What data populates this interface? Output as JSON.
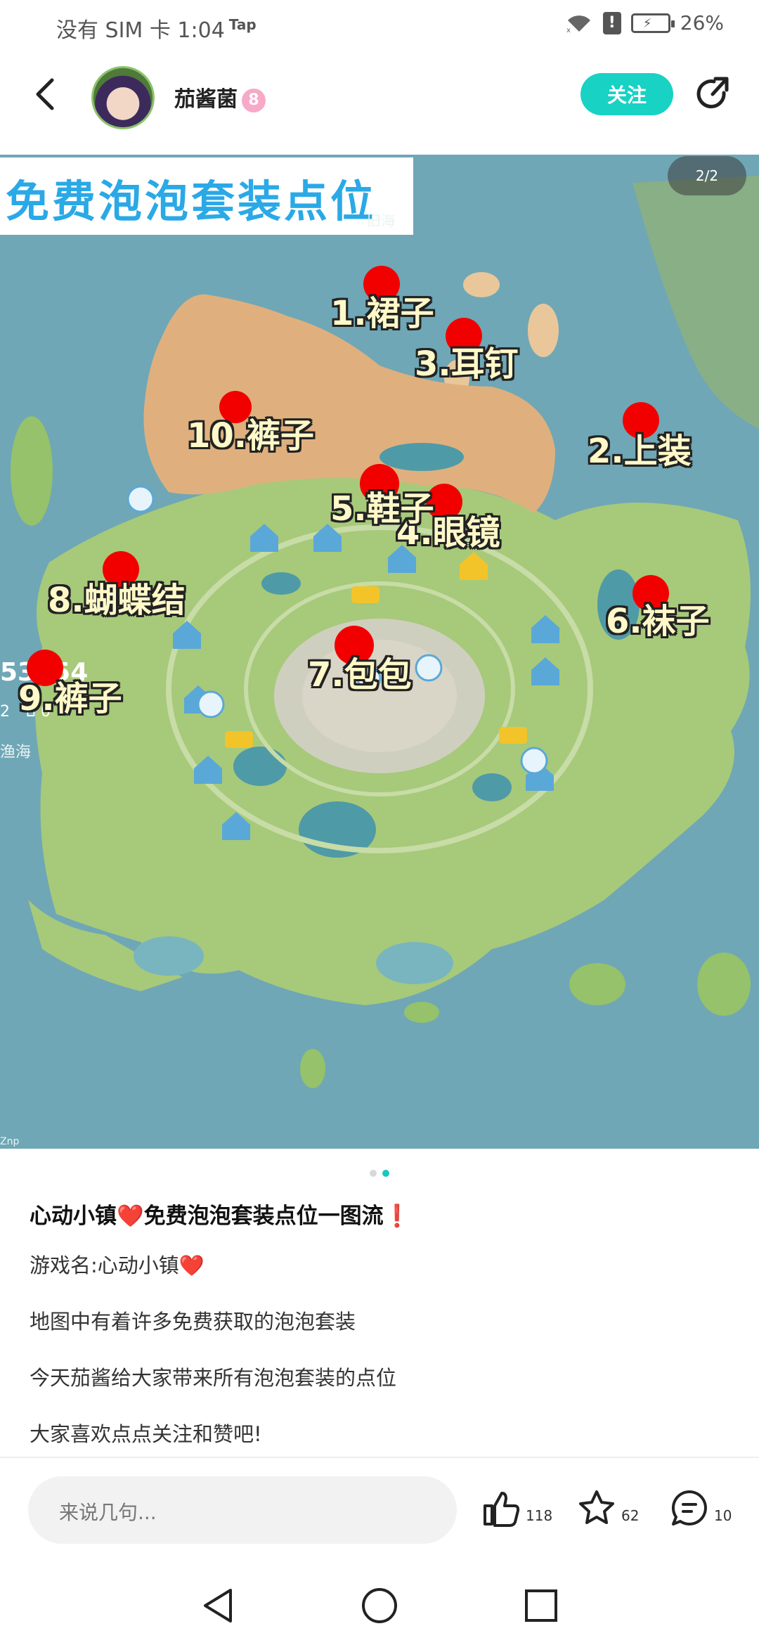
{
  "status_bar": {
    "carrier": "没有 SIM 卡",
    "time": "1:04",
    "tap_badge": "Tap",
    "alert_icon_text": "!",
    "battery": "26%"
  },
  "header": {
    "username": "茄酱菌",
    "level": "8",
    "follow_label": "关注"
  },
  "map_image": {
    "banner_title": "免费泡泡套装点位",
    "page_indicator": "2/2",
    "markers": [
      {
        "label": "1.裙子"
      },
      {
        "label": "2.上装"
      },
      {
        "label": "3.耳钉"
      },
      {
        "label": "4.眼镜"
      },
      {
        "label": "5.鞋子"
      },
      {
        "label": "6.袜子"
      },
      {
        "label": "7.包包"
      },
      {
        "label": "8.蝴蝶结"
      },
      {
        "label": "9.裤子"
      },
      {
        "label": "10.裤子"
      }
    ],
    "map_texts": {
      "old_sea": "旧海",
      "side_number": "53354",
      "side_sub_a": "2",
      "side_sub_b": "0",
      "sea": "渔海",
      "corner": "Znp"
    }
  },
  "post": {
    "title": "心动小镇❤️免费泡泡套装点位一图流❗",
    "lines": [
      "游戏名:心动小镇❤️",
      "地图中有着许多免费获取的泡泡套装",
      "今天茄酱给大家带来所有泡泡套装的点位",
      "大家喜欢点点关注和赞吧!"
    ]
  },
  "bottom_bar": {
    "comment_placeholder": "来说几句...",
    "likes": "118",
    "favorites": "62",
    "comments": "10"
  },
  "colors": {
    "accent": "#18d2c4",
    "marker": "#f20000",
    "banner_text": "#2aa9e6"
  }
}
